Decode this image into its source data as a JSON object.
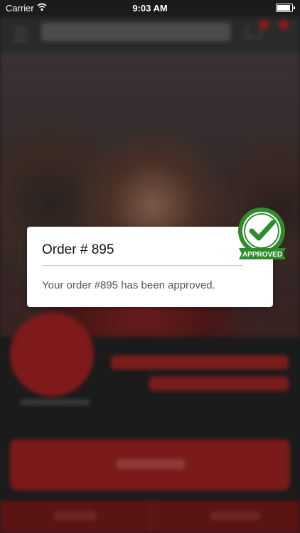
{
  "status_bar": {
    "carrier": "Carrier",
    "time": "9:03 AM",
    "battery_level_percent": 90
  },
  "modal": {
    "title": "Order # 895",
    "message": "Your order #895 has been approved.",
    "badge_label": "APPROVED"
  },
  "colors": {
    "badge_green": "#2e8b2e",
    "brand_red": "#c8102e"
  }
}
